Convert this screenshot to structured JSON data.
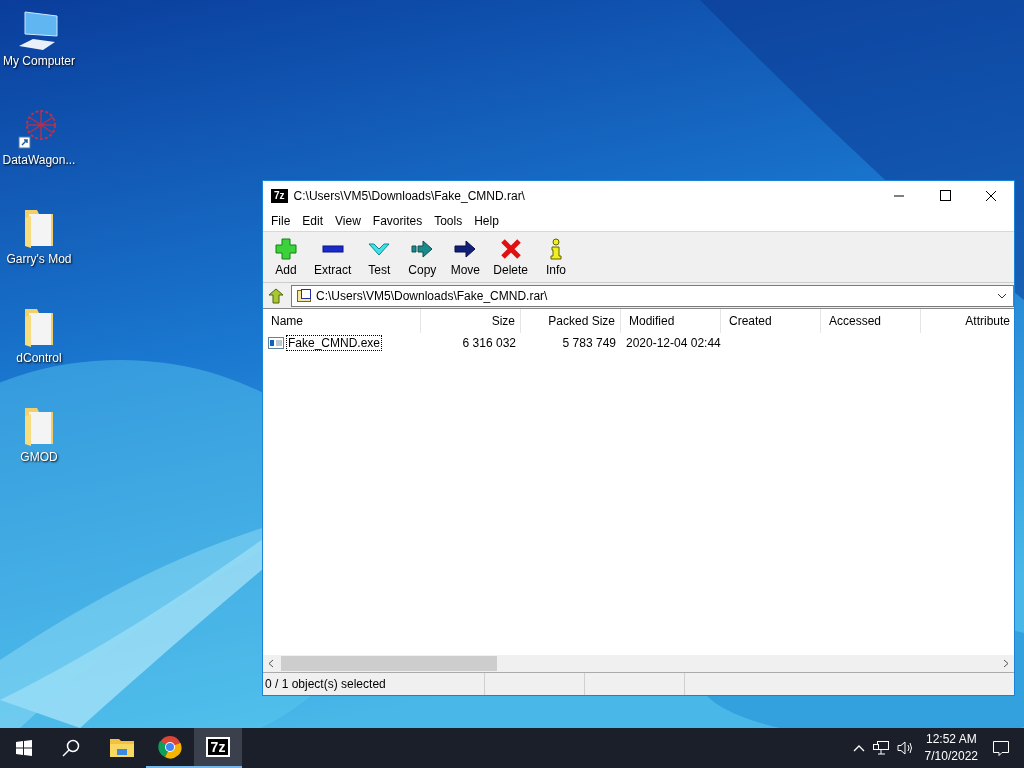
{
  "desktop_icons": [
    {
      "label": "My Computer",
      "kind": "computer"
    },
    {
      "label": "DataWagon...",
      "kind": "shortcut"
    },
    {
      "label": "Garry's Mod",
      "kind": "folder"
    },
    {
      "label": "dControl",
      "kind": "folder"
    },
    {
      "label": "GMOD",
      "kind": "folder"
    }
  ],
  "window": {
    "title_icon": "7z",
    "title": "C:\\Users\\VM5\\Downloads\\Fake_CMND.rar\\",
    "menu": [
      "File",
      "Edit",
      "View",
      "Favorites",
      "Tools",
      "Help"
    ],
    "toolbar": [
      {
        "label": "Add",
        "kind": "add"
      },
      {
        "label": "Extract",
        "kind": "extract"
      },
      {
        "label": "Test",
        "kind": "test"
      },
      {
        "label": "Copy",
        "kind": "copy"
      },
      {
        "label": "Move",
        "kind": "move"
      },
      {
        "label": "Delete",
        "kind": "delete"
      },
      {
        "label": "Info",
        "kind": "info"
      }
    ],
    "address": "C:\\Users\\VM5\\Downloads\\Fake_CMND.rar\\",
    "columns": [
      {
        "label": "Name",
        "kind": "text"
      },
      {
        "label": "Size",
        "kind": "number"
      },
      {
        "label": "Packed Size",
        "kind": "number"
      },
      {
        "label": "Modified",
        "kind": "text"
      },
      {
        "label": "Created",
        "kind": "text"
      },
      {
        "label": "Accessed",
        "kind": "text"
      },
      {
        "label": "Attribute",
        "kind": "number"
      }
    ],
    "rows": [
      {
        "cells": [
          "Fake_CMND.exe",
          "6 316 032",
          "5 783 749",
          "2020-12-04 02:44"
        ],
        "selected": false,
        "focused": true
      }
    ],
    "status_bar": [
      "0 / 1 object(s) selected"
    ]
  },
  "taskbar": {
    "apps": [
      {
        "kind": "explorer",
        "running": false,
        "active": false
      },
      {
        "kind": "chrome",
        "running": true,
        "active": false
      },
      {
        "kind": "sevenzip",
        "label": "7z",
        "running": true,
        "active": true
      }
    ],
    "time": "12:52 AM",
    "date": "7/10/2022"
  }
}
